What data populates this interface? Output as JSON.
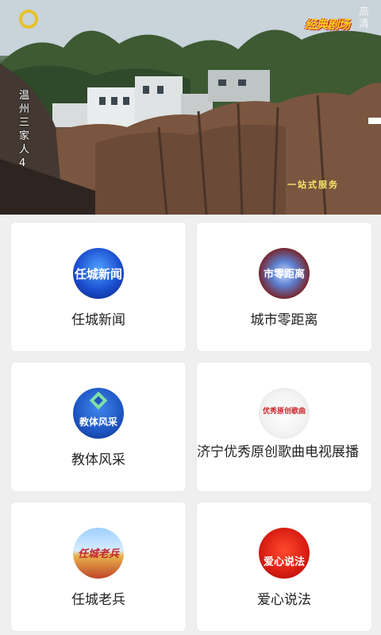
{
  "hero": {
    "vertical_title": "温州三家人4",
    "hd_label": "高清",
    "program_badge": "经典剧场",
    "service_tag": "一站式服务"
  },
  "cards": [
    {
      "label": "任城新闻",
      "thumb_text": "任城新闻",
      "icon": "news-thumb"
    },
    {
      "label": "城市零距离",
      "thumb_text": "市零距离",
      "icon": "city-thumb"
    },
    {
      "label": "教体风采",
      "thumb_text": "教体风采",
      "icon": "education-thumb"
    },
    {
      "label": "济宁优秀原创歌曲电视展播",
      "thumb_text": "优秀原创歌曲",
      "icon": "song-thumb"
    },
    {
      "label": "任城老兵",
      "thumb_text": "任城老兵",
      "icon": "veteran-thumb"
    },
    {
      "label": "爱心说法",
      "thumb_text": "爱心说法",
      "icon": "law-thumb"
    }
  ]
}
